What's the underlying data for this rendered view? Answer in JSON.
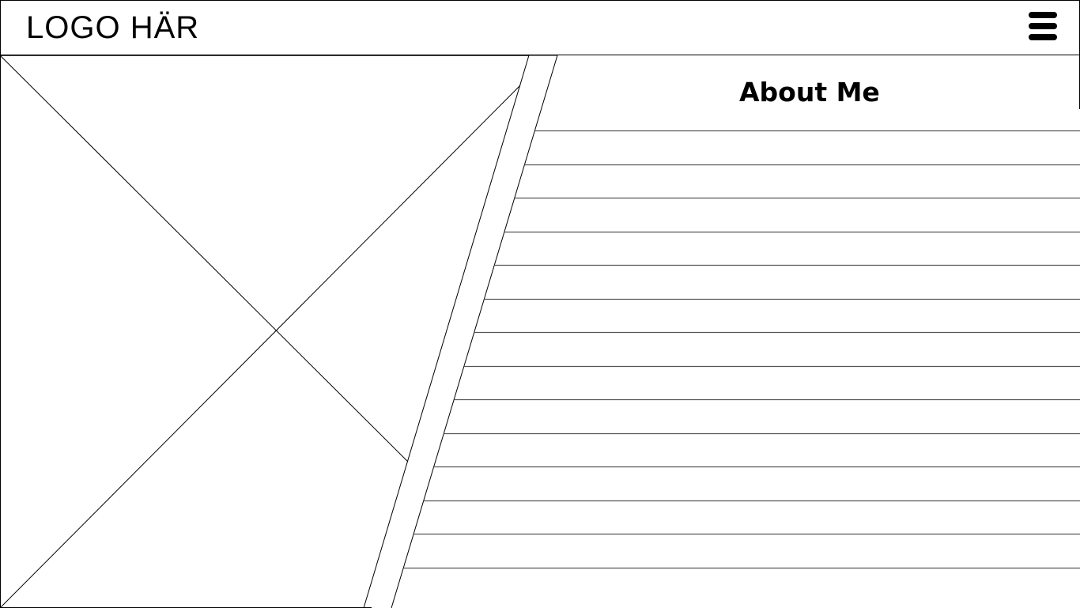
{
  "header": {
    "logo_text": "LOGO HÄR",
    "menu_icon": "hamburger-menu-icon"
  },
  "main": {
    "image_placeholder_icon": "image-placeholder-icon",
    "about": {
      "title": "About Me",
      "text_placeholder_line_count": 14
    }
  }
}
